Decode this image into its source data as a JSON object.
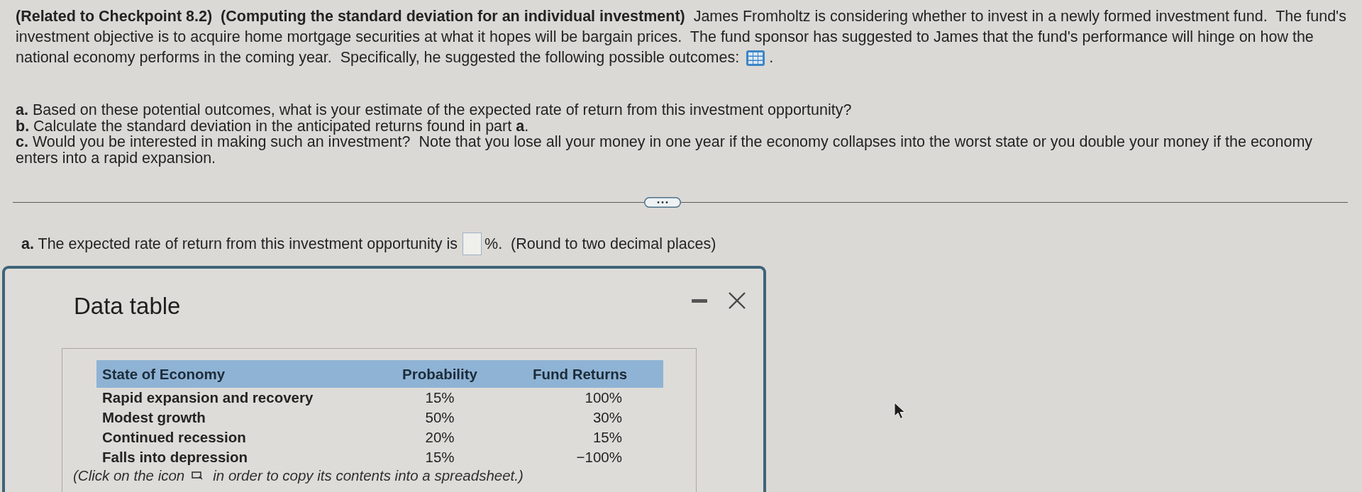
{
  "problem": {
    "text": "**(Related to Checkpoint 8.2)**  **(Computing the standard deviation for an individual investment)**  James Fromholtz is considering whether to invest in a newly formed investment fund.  The fund's investment objective is to acquire home mortgage securities at what it hopes will be bargain prices.  The fund sponsor has suggested to James that the fund's performance will hinge on how the national economy performs in the coming year.  Specifically, he suggested the following possible outcomes:",
    "end": "."
  },
  "questions": [
    "**a.** Based on these potential outcomes, what is your estimate of the expected rate of return from this investment opportunity?",
    "**b.** Calculate the standard deviation in the anticipated returns found in part **a**.",
    "**c.** Would you be interested in making such an investment?  Note that you lose all your money in one year if the economy collapses into the worst state or you double your money if the economy enters into a rapid expansion."
  ],
  "answer": {
    "prompt": "**a.** The expected rate of return from this investment opportunity is",
    "suffix": "%.  (Round to two decimal places)"
  },
  "data_table": {
    "title": "Data table",
    "columns": [
      "State of Economy",
      "Probability",
      "Fund Returns"
    ],
    "rows": [
      [
        "Rapid expansion and recovery",
        "15%",
        "100%"
      ],
      [
        "Modest growth",
        "50%",
        "30%"
      ],
      [
        "Continued recession",
        "20%",
        "15%"
      ],
      [
        "Falls into depression",
        "15%",
        "−100%"
      ]
    ],
    "note": {
      "before": "(Click on the icon",
      "after": "in order to copy its contents into a spreadsheet.)"
    }
  }
}
